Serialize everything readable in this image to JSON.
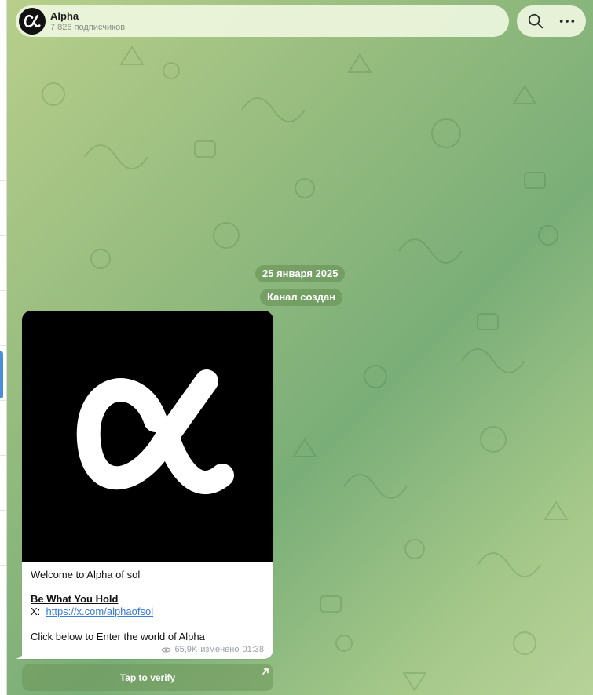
{
  "channel": {
    "title": "Alpha",
    "subscribers": "7 826 подписчиков"
  },
  "header_tools": {
    "search_icon": "search-icon",
    "more_icon": "more-icon"
  },
  "service_messages": {
    "date": "25 января 2025",
    "created": "Канал создан"
  },
  "message": {
    "line1": "Welcome to Alpha of sol",
    "headline": "Be What You Hold",
    "x_label": "X:",
    "x_link": "https://x.com/alphaofsol",
    "line4": "Click below to Enter the world of Alpha",
    "views": "65,9K",
    "edited": "изменено",
    "time": "01:38"
  },
  "inline_button": {
    "label": "Tap to verify"
  },
  "colors": {
    "accent": "#3a7bd5",
    "bubble": "#ffffff",
    "header_bg": "#eef6de"
  }
}
